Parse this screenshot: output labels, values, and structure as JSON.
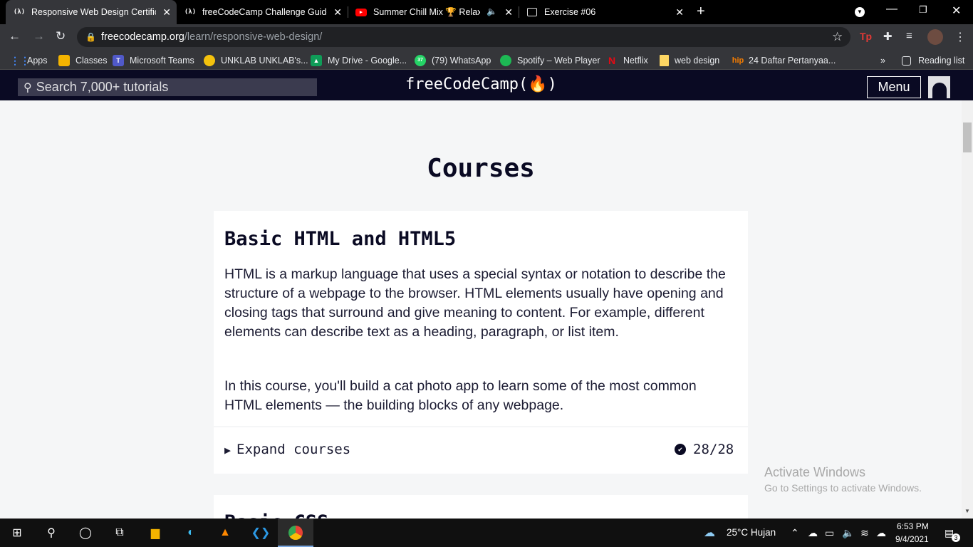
{
  "browser": {
    "tabs": [
      {
        "title": "Responsive Web Design Certifica",
        "favicon": "(λ)",
        "active": true
      },
      {
        "title": "freeCodeCamp Challenge Guide:",
        "favicon": "(λ)",
        "active": false
      },
      {
        "title": "Summer Chill Mix 🏆 Relaxin",
        "favicon": "youtube-icon",
        "active": false
      },
      {
        "title": "Exercise #06",
        "favicon": "page-icon",
        "active": false
      }
    ],
    "url_host": "freecodecamp.org",
    "url_path": "/learn/responsive-web-design/",
    "bookmarks": [
      {
        "label": "Apps",
        "color": "#4285f4"
      },
      {
        "label": "Classes",
        "color": "#f4b400"
      },
      {
        "label": "Microsoft Teams",
        "color": "#5059c9"
      },
      {
        "label": "UNKLAB UNKLAB's...",
        "color": "#f4c20d"
      },
      {
        "label": "My Drive - Google...",
        "color": "#0f9d58"
      },
      {
        "label": "(79) WhatsApp",
        "color": "#25d366"
      },
      {
        "label": "Spotify – Web Player",
        "color": "#1db954"
      },
      {
        "label": "Netflix",
        "color": "#e50914"
      },
      {
        "label": "web design",
        "color": "#fdd663"
      },
      {
        "label": "24 Daftar Pertanyaa...",
        "color": "#f57c00"
      }
    ],
    "bookmarks_more": "»",
    "reading_list": "Reading list"
  },
  "fcc": {
    "search_placeholder": "Search 7,000+ tutorials",
    "brand": "freeCodeCamp(🔥)",
    "menu_label": "Menu"
  },
  "page": {
    "heading": "Courses",
    "course": {
      "title": "Basic HTML and HTML5",
      "description_1": "HTML is a markup language that uses a special syntax or notation to describe the structure of a webpage to the browser. HTML elements usually have opening and closing tags that surround and give meaning to content. For example, different elements can describe text as a heading, paragraph, or list item.",
      "description_2": "In this course, you'll build a cat photo app to learn some of the most common HTML elements — the building blocks of any webpage.",
      "expand_label": "Expand courses",
      "progress": "28/28"
    },
    "next_course_title_partial": "Basic CSS"
  },
  "os": {
    "activate_title": "Activate Windows",
    "activate_sub": "Go to Settings to activate Windows.",
    "weather": "25°C  Hujan",
    "time": "6:53 PM",
    "date": "9/4/2021",
    "notifications": "3"
  }
}
